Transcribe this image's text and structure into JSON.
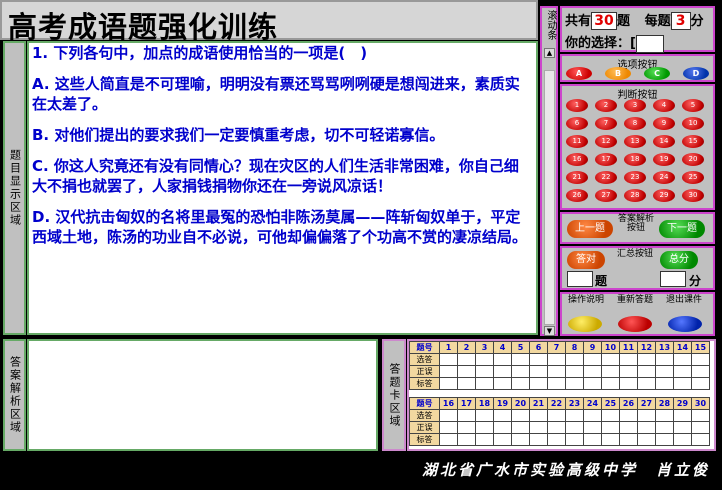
{
  "app": {
    "title": "高考成语题强化训练"
  },
  "labels": {
    "question_area": "题目显示区域",
    "analysis_area": "答案解析区域",
    "answer_card_area": "答题卡区域",
    "scrollbar": "滚动条"
  },
  "question": {
    "stem": "1. 下列各句中，加点的成语使用恰当的一项是(　)",
    "options": [
      "A. 这些人简直是不可理喻，明明没有票还骂骂咧咧硬是想闯进来，素质实在太差了。",
      "B. 对他们提出的要求我们一定要慎重考虑，切不可轻诺寡信。",
      "C. 你这人究竟还有没有同情心？现在灾区的人们生活非常困难，你自己细大不捐也就罢了，人家捐钱捐物你还在一旁说风凉话！",
      "D. 汉代抗击匈奴的名将里最冤的恐怕非陈汤莫属——阵斩匈奴单于，平定西域土地，陈汤的功业自不必说，可他却偏偏落了个功高不赏的凄凉结局。"
    ]
  },
  "stats": {
    "total_prefix": "共有",
    "total": "30",
    "total_suffix": "题",
    "per_prefix": "每题",
    "per": "3",
    "per_suffix": "分",
    "choice_label": "你的选择：["
  },
  "option_buttons": {
    "title": "选项按钮",
    "items": [
      {
        "label": "A",
        "color": "#cc0000"
      },
      {
        "label": "B",
        "color": "#ee8800"
      },
      {
        "label": "C",
        "color": "#009900"
      },
      {
        "label": "D",
        "color": "#0033aa"
      }
    ]
  },
  "judge_buttons": {
    "title": "判断按钮",
    "items": [
      "1",
      "2",
      "3",
      "4",
      "5",
      "6",
      "7",
      "8",
      "9",
      "10",
      "11",
      "12",
      "13",
      "14",
      "15",
      "16",
      "17",
      "18",
      "19",
      "20",
      "21",
      "22",
      "23",
      "24",
      "25",
      "26",
      "27",
      "28",
      "29",
      "30"
    ]
  },
  "nav": {
    "prev": "上一题",
    "mid_label": "答案解析按钮",
    "next": "下一题"
  },
  "summary": {
    "correct": "答对",
    "mid_label": "汇总按钮",
    "total_score": "总分",
    "q_unit": "题",
    "score_unit": "分"
  },
  "actions": {
    "instructions": "操作说明",
    "restart": "重新答题",
    "exit": "退出课件"
  },
  "answer_card": {
    "row_labels": [
      "题号",
      "选答",
      "正误",
      "标答"
    ],
    "group1": [
      "1",
      "2",
      "3",
      "4",
      "5",
      "6",
      "7",
      "8",
      "9",
      "10",
      "11",
      "12",
      "13",
      "14",
      "15"
    ],
    "group2": [
      "16",
      "17",
      "18",
      "19",
      "20",
      "21",
      "22",
      "23",
      "24",
      "25",
      "26",
      "27",
      "28",
      "29",
      "30"
    ]
  },
  "footer": {
    "author": "湖北省广水市实验高级中学　肖立俊"
  }
}
